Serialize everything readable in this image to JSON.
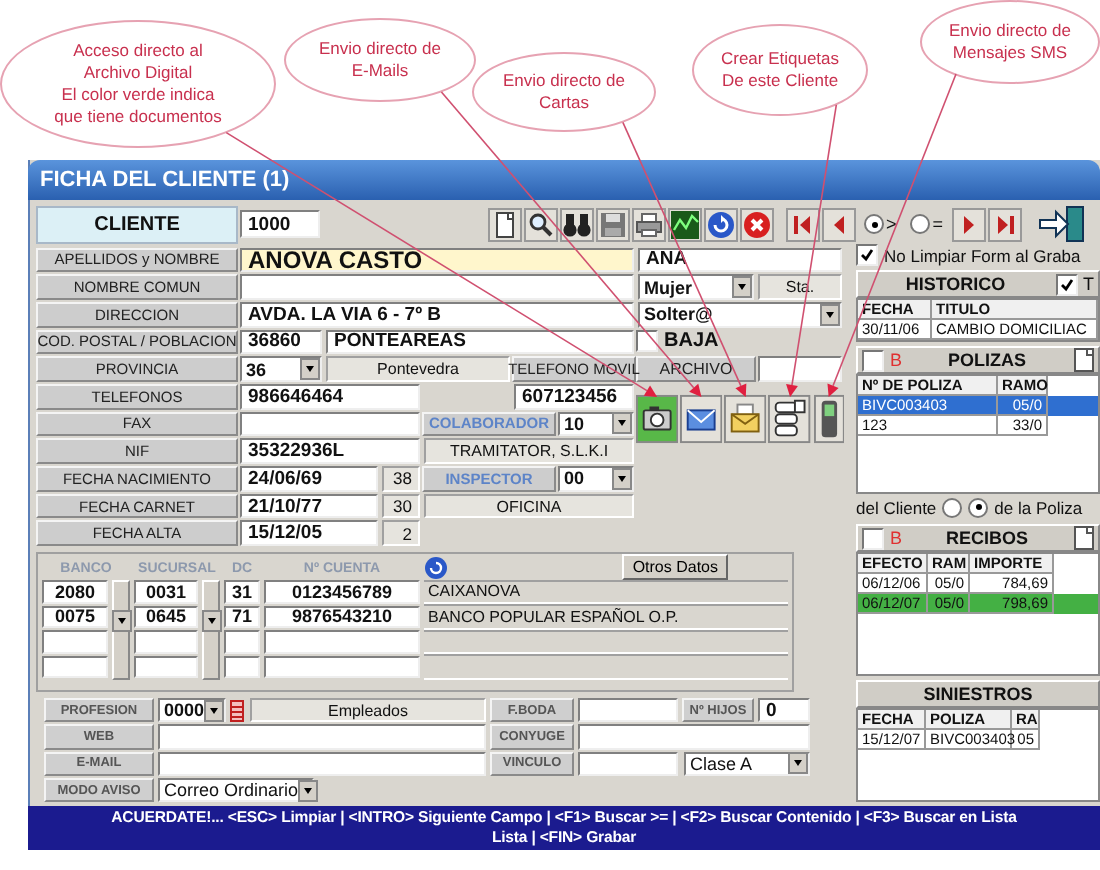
{
  "callouts": [
    {
      "lines": [
        "Acceso directo al",
        "Archivo Digital",
        "El color verde indica",
        "que tiene documentos"
      ]
    },
    {
      "lines": [
        "Envio directo de",
        "E-Mails"
      ]
    },
    {
      "lines": [
        "Envio directo de",
        "Cartas"
      ]
    },
    {
      "lines": [
        "Crear Etiquetas",
        "De este Cliente"
      ]
    },
    {
      "lines": [
        "Envio directo de",
        "Mensajes SMS"
      ]
    }
  ],
  "window": {
    "title": "FICHA DEL CLIENTE (1)"
  },
  "cliente": {
    "label": "CLIENTE",
    "value": "1000"
  },
  "search_mode": [
    {
      "label": ">",
      "selected": true
    },
    {
      "label": "=",
      "selected": false
    }
  ],
  "rows": [
    {
      "label": "APELLIDOS y NOMBRE",
      "kind": "text",
      "value": "ANOVA CASTO",
      "focused": true
    },
    {
      "label": "NOMBRE COMUN",
      "kind": "text",
      "focused": false
    },
    {
      "label": "DIRECCION",
      "kind": "text",
      "value": "AVDA. LA VIA 6 - 7º B",
      "focused": false
    },
    {
      "label": "COD. POSTAL / POBLACION",
      "kind": "postal",
      "value": "36860",
      "value_2": "PONTEAREAS",
      "focused": false
    },
    {
      "label": "PROVINCIA",
      "kind": "select",
      "value": "36",
      "value_2": "Pontevedra",
      "focused": false
    },
    {
      "label": "TELEFONOS",
      "kind": "short",
      "value": "986646464",
      "focused": false
    },
    {
      "label": "FAX",
      "kind": "short",
      "focused": false
    },
    {
      "label": "NIF",
      "kind": "short",
      "value": "35322936L",
      "focused": false
    },
    {
      "label": "FECHA NACIMIENTO",
      "kind": "date",
      "value": "24/06/69",
      "age": "38",
      "focused": false
    },
    {
      "label": "FECHA CARNET",
      "kind": "date",
      "value": "21/10/77",
      "age": "30",
      "focused": false
    },
    {
      "label": "FECHA ALTA",
      "kind": "date",
      "value": "15/12/05",
      "age": "2",
      "focused": false
    }
  ],
  "nombre": "ANA",
  "sexo": "Mujer",
  "tratamiento": "Sta.",
  "estado_civil": "Solter@",
  "baja": {
    "label": "BAJA",
    "checked": false
  },
  "archivo": {
    "label": "ARCHIVO"
  },
  "archivo_digital": {
    "has_documents": true
  },
  "movil": {
    "label": "TELEFONO MOVIL",
    "value": "607123456"
  },
  "colaborador": {
    "label": "COLABORADOR",
    "code": "10",
    "name": "TRAMITATOR, S.L.K.I"
  },
  "inspector": {
    "label": "INSPECTOR",
    "code": "00",
    "name": "OFICINA"
  },
  "bank": {
    "columns": [
      "BANCO",
      "SUCURSAL",
      "DC",
      "Nº CUENTA"
    ],
    "otros_datos": "Otros Datos",
    "rows": [
      {
        "banco": "2080",
        "sucursal": "0031",
        "dc": "31",
        "cuenta": "0123456789",
        "entidad": "CAIXANOVA"
      },
      {
        "banco": "0075",
        "sucursal": "0645",
        "dc": "71",
        "cuenta": "9876543210",
        "entidad": "BANCO POPULAR ESPAÑOL O.P."
      }
    ]
  },
  "extra": {
    "profesion": {
      "label": "PROFESION",
      "code": "0000",
      "name": "Empleados"
    },
    "web": {
      "label": "WEB"
    },
    "email": {
      "label": "E-MAIL"
    },
    "modo_aviso": {
      "label": "MODO AVISO",
      "value": "Correo Ordinario"
    },
    "f_boda": {
      "label": "F.BODA"
    },
    "hijos": {
      "label": "Nº HIJOS",
      "value": "0"
    },
    "conyuge": {
      "label": "CONYUGE"
    },
    "vinculo": {
      "label": "VINCULO"
    },
    "clase": "Clase A"
  },
  "no_limpiar": {
    "label": "No Limpiar Form al Graba",
    "checked": true
  },
  "historico": {
    "kind": "history",
    "title": "HISTORICO",
    "filter": {
      "label": "T",
      "checked": true
    },
    "columns": [
      "FECHA",
      "TITULO"
    ],
    "rows": [
      {
        "cells": [
          "30/11/06",
          "CAMBIO DOMICILIAC"
        ]
      }
    ]
  },
  "polizas": {
    "kind": "list",
    "title": "POLIZAS",
    "filter": {
      "label": "B",
      "checked": false
    },
    "columns": [
      "Nº DE POLIZA",
      "RAMO"
    ],
    "rows": [
      {
        "cells": [
          "BIVC003403",
          "05/0"
        ],
        "selected": true
      },
      {
        "cells": [
          "123",
          "33/0"
        ],
        "selected": false
      }
    ]
  },
  "scope": [
    {
      "label": "del Cliente",
      "selected": false
    },
    {
      "label": "de la Poliza",
      "selected": true
    }
  ],
  "recibos": {
    "kind": "list",
    "title": "RECIBOS",
    "filter": {
      "label": "B",
      "checked": false
    },
    "columns": [
      "EFECTO",
      "RAM",
      "IMPORTE"
    ],
    "rows": [
      {
        "cells": [
          "06/12/06",
          "05/0",
          "784,69"
        ],
        "color": "#ffffff"
      },
      {
        "cells": [
          "06/12/07",
          "05/0",
          "798,69"
        ],
        "color": "#44b044"
      }
    ]
  },
  "siniestros": {
    "kind": "plain",
    "title": "SINIESTROS",
    "columns": [
      "FECHA",
      "POLIZA",
      "RA"
    ],
    "rows": [
      {
        "cells": [
          "15/12/07",
          "BIVC003403",
          "05"
        ]
      }
    ]
  },
  "status_bar": {
    "lines": [
      "ACUERDATE!...  <ESC> Limpiar | <INTRO> Siguiente Campo | <F1> Buscar >= | <F2> Buscar Contenido | <F3> Buscar en Lista",
      "Lista | <FIN> Grabar"
    ]
  }
}
